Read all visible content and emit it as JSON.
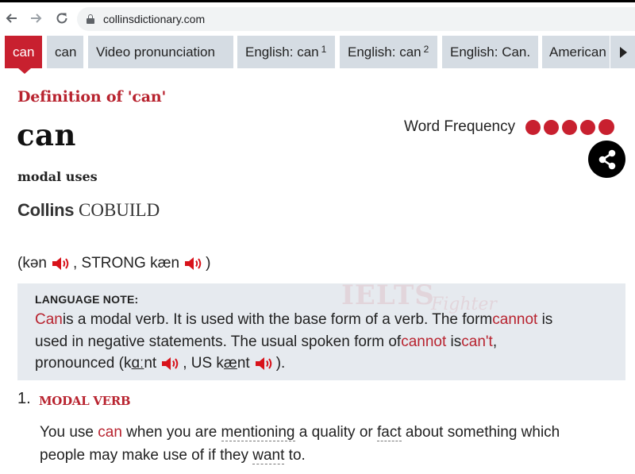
{
  "browser": {
    "url": "collinsdictionary.com"
  },
  "tabs": [
    {
      "label": "can",
      "sup": ""
    },
    {
      "label": "can",
      "sup": ""
    },
    {
      "label": "Video pronunciation",
      "sup": ""
    },
    {
      "label": "English: can",
      "sup": "1"
    },
    {
      "label": "English: can",
      "sup": "2"
    },
    {
      "label": "English: Can.",
      "sup": ""
    },
    {
      "label": "American",
      "sup": ""
    }
  ],
  "entry": {
    "definition_title": "Definition of 'can'",
    "headword": "can",
    "word_frequency_label": "Word Frequency",
    "word_frequency_level": 5,
    "word_frequency_max": 5,
    "subtitle": "modal uses",
    "source_brand": "Collins",
    "source_name": "COBUILD"
  },
  "pronunciation": {
    "open": "(",
    "weak": "kən",
    "sep": ", STRONG",
    "strong": "kæn",
    "close": ")"
  },
  "language_note": {
    "heading": "LANGUAGE NOTE:",
    "line1": {
      "w1": "Can",
      "t1": " is a modal verb. It is used with the base form of a verb. The form ",
      "w2": "cannot",
      "t2": " is"
    },
    "line2": {
      "t1": "used in negative statements. The usual spoken form of ",
      "w1": "cannot",
      "t2": " is ",
      "w2": "can't",
      "t3": ","
    },
    "line3": {
      "t1": "pronounced (k",
      "u1": "ɑː",
      "t2": "nt",
      "t3": ", US k",
      "u2": "æ",
      "t4": "nt",
      "t5": ")."
    }
  },
  "watermark": {
    "main": "IELTS",
    "sub": "Fighter"
  },
  "sense": {
    "number": "1.",
    "pos": "MODAL VERB",
    "t1": "You use ",
    "w1": "can",
    "t2": " when you are ",
    "l1": "mentioning",
    "t3": " a quality or ",
    "l2": "fact",
    "t4": " about something which",
    "t5": "people may make use of if they ",
    "l3": "want",
    "t6": " to."
  },
  "colors": {
    "accent": "#c8202f",
    "tab_bg": "#d5dce3",
    "note_bg": "#e6eaef"
  }
}
